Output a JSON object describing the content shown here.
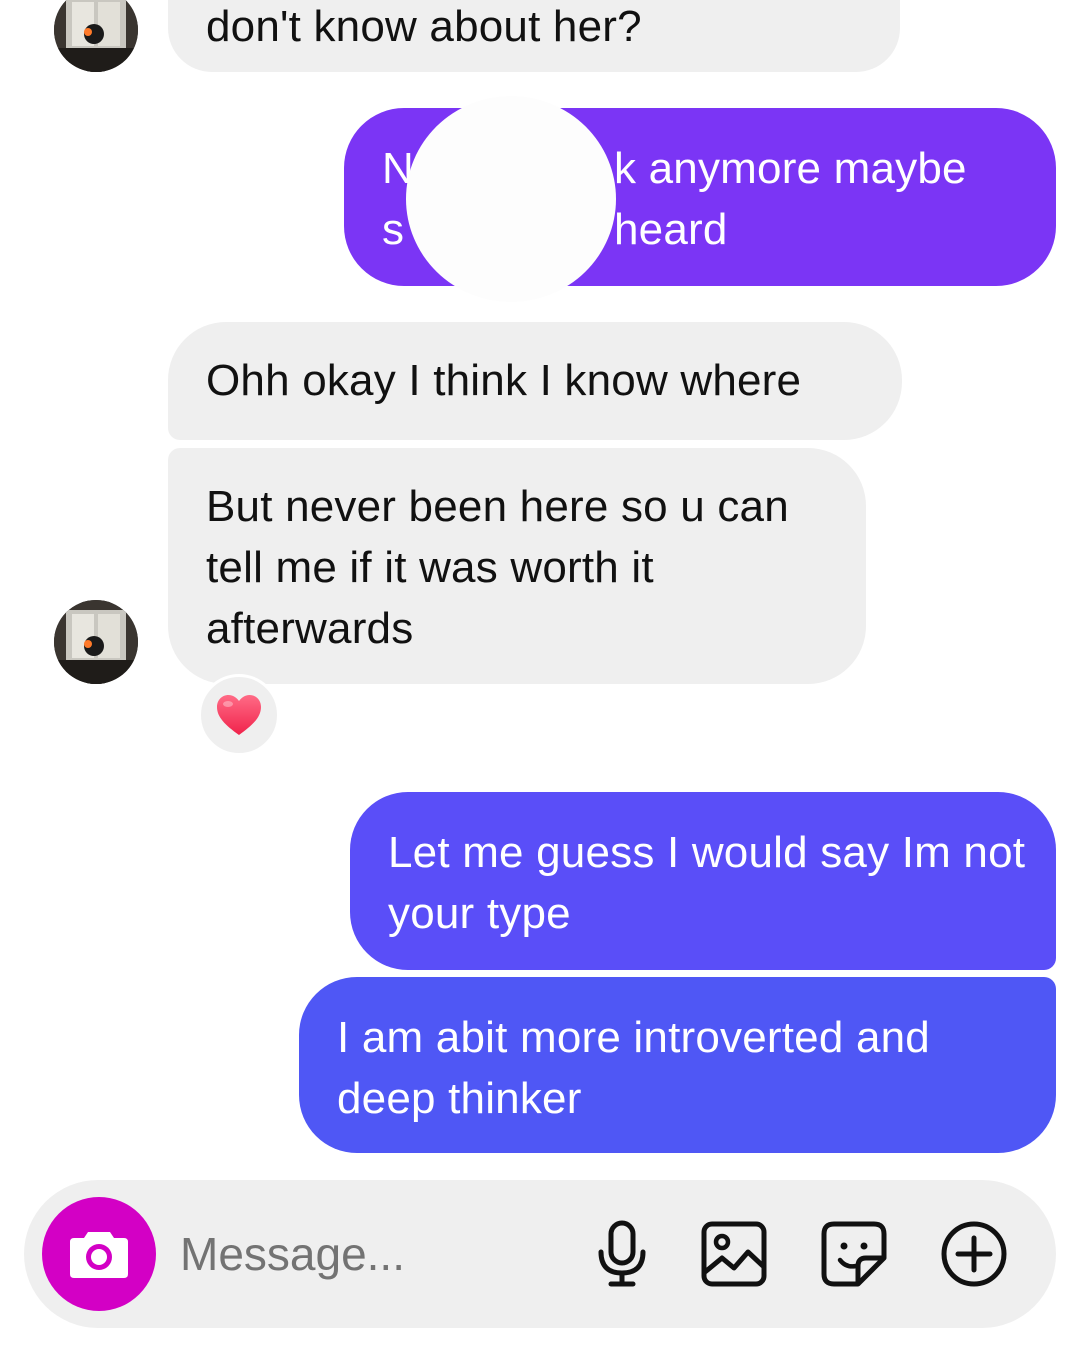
{
  "conversation": {
    "messages": [
      {
        "sender": "them",
        "text": "don't know about her?"
      },
      {
        "sender": "me",
        "line1_visible": "k anymore maybe",
        "line2_visible": "heard",
        "line1_start": "N",
        "line2_start": "s",
        "partially_obscured": true
      },
      {
        "sender": "them",
        "text": "Ohh okay I think I know where"
      },
      {
        "sender": "them",
        "text": "But never been here so u can tell me if it was worth it afterwards",
        "reaction": "heart"
      },
      {
        "sender": "me",
        "text": "Let me guess I would say Im not your type"
      },
      {
        "sender": "me",
        "text": "I am abit more introverted and deep thinker"
      }
    ]
  },
  "composer": {
    "placeholder": "Message...",
    "icons": [
      "camera-icon",
      "microphone-icon",
      "gallery-icon",
      "sticker-icon",
      "plus-icon"
    ]
  },
  "colors": {
    "incoming_bubble": "#efefef",
    "outgoing_top": "#7b35f5",
    "outgoing_mid": "#5a4ef8",
    "outgoing_bottom": "#4f57f5",
    "camera_button": "#d300c5",
    "reaction_heart": "#ff3b5c"
  }
}
